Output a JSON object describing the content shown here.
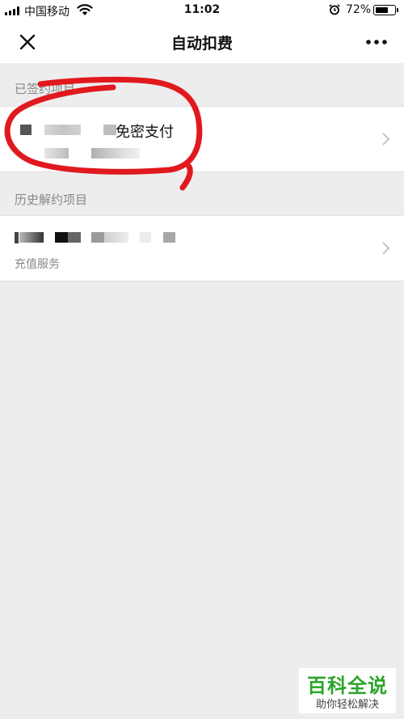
{
  "status_bar": {
    "carrier": "中国移动",
    "time": "11:02",
    "battery_percent": "72%",
    "battery_level": 0.72,
    "icons": [
      "signal-icon",
      "wifi-icon",
      "alarm-icon",
      "battery-icon"
    ]
  },
  "nav": {
    "title": "自动扣费",
    "close_icon": "close-icon",
    "more_icon": "more-icon"
  },
  "signed": {
    "header": "已签约项目",
    "items": [
      {
        "title": "免密支付",
        "title_partially_obscured": true
      }
    ]
  },
  "history": {
    "header": "历史解约项目",
    "items": [
      {
        "title_obscured": true,
        "subtitle": "充值服务"
      }
    ]
  },
  "watermark": {
    "main": "百科全说",
    "sub": "助你轻松解决"
  },
  "colors": {
    "background": "#ededed",
    "card": "#ffffff",
    "secondary_text": "#888888",
    "annotation": "#e0191f",
    "watermark_green": "#2aa52a"
  }
}
